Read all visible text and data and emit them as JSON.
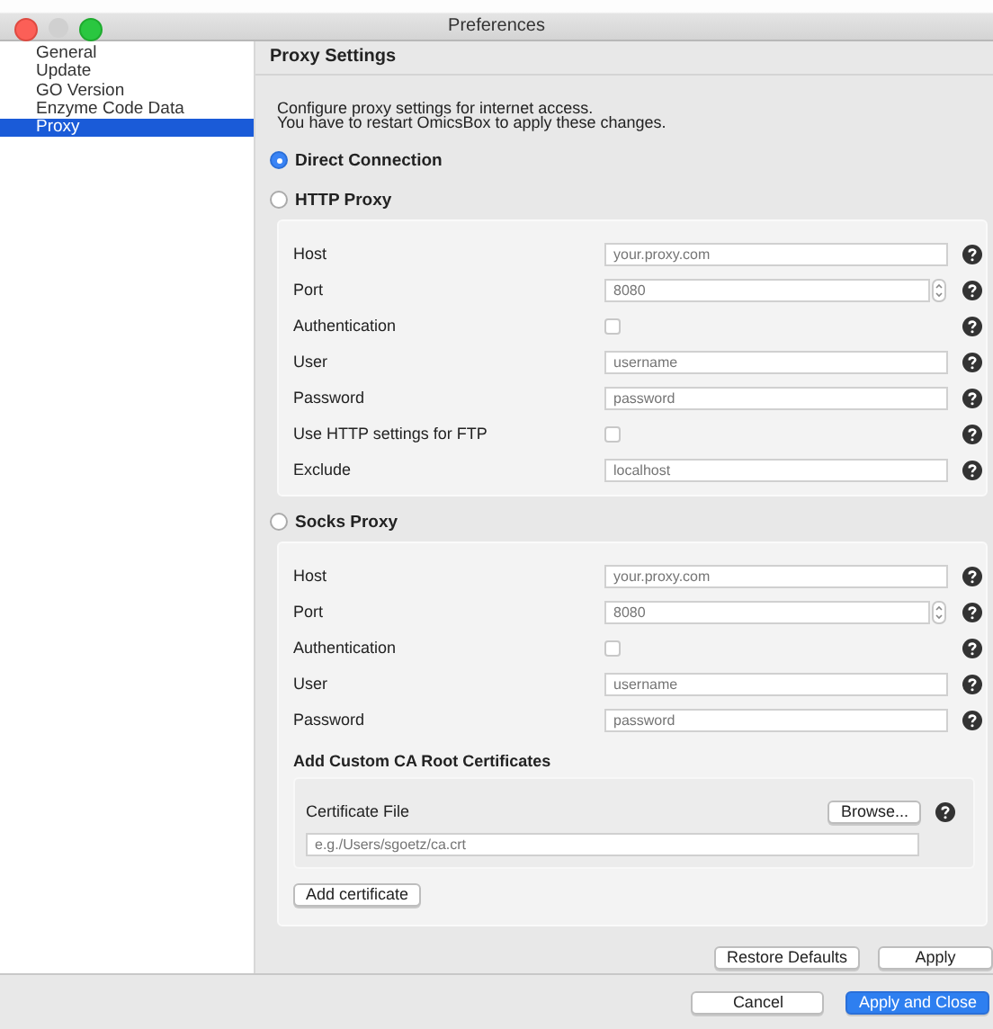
{
  "window": {
    "title": "Preferences"
  },
  "sidebar": {
    "items": [
      {
        "label": "General",
        "selected": false
      },
      {
        "label": "Update",
        "selected": false
      },
      {
        "label": "GO Version",
        "selected": false
      },
      {
        "label": "Enzyme Code Data",
        "selected": false
      },
      {
        "label": "Proxy",
        "selected": true
      }
    ]
  },
  "header": {
    "title": "Proxy Settings"
  },
  "description": [
    "Configure proxy settings for internet access.",
    "You have to restart OmicsBox to apply these changes."
  ],
  "proxy_options": [
    {
      "label": "Direct Connection",
      "selected": true
    },
    {
      "label": "HTTP Proxy",
      "selected": false,
      "fields": [
        {
          "label": "Host",
          "kind": "text",
          "placeholder": "your.proxy.com"
        },
        {
          "label": "Port",
          "kind": "number",
          "placeholder": "8080"
        },
        {
          "label": "Authentication",
          "kind": "checkbox",
          "checked": false
        },
        {
          "label": "User",
          "kind": "text",
          "placeholder": "username"
        },
        {
          "label": "Password",
          "kind": "text",
          "placeholder": "password"
        },
        {
          "label": "Use HTTP settings for FTP",
          "kind": "checkbox",
          "checked": false
        },
        {
          "label": "Exclude",
          "kind": "text",
          "placeholder": "localhost"
        }
      ]
    },
    {
      "label": "Socks Proxy",
      "selected": false,
      "fields": [
        {
          "label": "Host",
          "kind": "text",
          "placeholder": "your.proxy.com"
        },
        {
          "label": "Port",
          "kind": "number",
          "placeholder": "8080"
        },
        {
          "label": "Authentication",
          "kind": "checkbox",
          "checked": false
        },
        {
          "label": "User",
          "kind": "text",
          "placeholder": "username"
        },
        {
          "label": "Password",
          "kind": "text",
          "placeholder": "password"
        }
      ],
      "certificates": {
        "title": "Add Custom CA Root Certificates",
        "file_label": "Certificate File",
        "browse_button": "Browse...",
        "placeholder": "e.g./Users/sgoetz/ca.crt",
        "add_button": "Add certificate"
      }
    }
  ],
  "page_buttons": [
    "Restore Defaults",
    "Apply"
  ],
  "dialog_buttons": [
    {
      "label": "Cancel",
      "kind": "normal"
    },
    {
      "label": "Apply and Close",
      "kind": "default"
    }
  ]
}
